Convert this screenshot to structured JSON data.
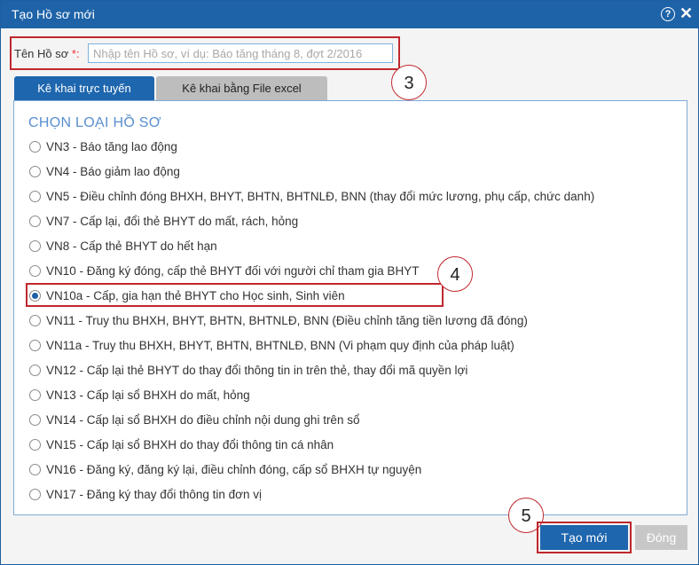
{
  "dialog": {
    "title": "Tạo Hồ sơ mới",
    "help_glyph": "?",
    "close_glyph": "✕"
  },
  "name_field": {
    "label": "Tên Hồ sơ",
    "required_mark": "*:",
    "placeholder": "Nhập tên Hồ sơ, ví dụ: Báo tăng tháng 8, đợt 2/2016",
    "value": ""
  },
  "tabs": [
    {
      "label": "Kê khai trực tuyến",
      "active": true
    },
    {
      "label": "Kê khai bằng File excel",
      "active": false
    }
  ],
  "section_title": "CHỌN LOẠI HỒ SƠ",
  "options": [
    {
      "label": "VN3 - Báo tăng lao động",
      "selected": false
    },
    {
      "label": "VN4 - Báo giảm lao động",
      "selected": false
    },
    {
      "label": "VN5 - Điều chỉnh đóng BHXH, BHYT, BHTN, BHTNLĐ, BNN (thay đổi mức lương, phụ cấp, chức danh)",
      "selected": false
    },
    {
      "label": "VN7 - Cấp lại, đổi thẻ BHYT do mất, rách, hỏng",
      "selected": false
    },
    {
      "label": "VN8 - Cấp thẻ BHYT do hết hạn",
      "selected": false
    },
    {
      "label": "VN10 - Đăng ký đóng, cấp thẻ BHYT đối với người chỉ tham gia BHYT",
      "selected": false
    },
    {
      "label": "VN10a - Cấp, gia hạn thẻ BHYT cho Học sinh, Sinh viên",
      "selected": true
    },
    {
      "label": "VN11 - Truy thu BHXH, BHYT, BHTN, BHTNLĐ, BNN (Điều chỉnh tăng tiền lương đã đóng)",
      "selected": false
    },
    {
      "label": "VN11a - Truy thu BHXH, BHYT, BHTN, BHTNLĐ, BNN (Vi phạm quy định của pháp luật)",
      "selected": false
    },
    {
      "label": "VN12 - Cấp lại thẻ BHYT do thay đổi thông tin in trên thẻ, thay đổi mã quyền lợi",
      "selected": false
    },
    {
      "label": "VN13 - Cấp lại sổ BHXH do mất, hỏng",
      "selected": false
    },
    {
      "label": "VN14 - Cấp lại sổ BHXH do điều chỉnh nội dung ghi trên sổ",
      "selected": false
    },
    {
      "label": "VN15 - Cấp lại sổ BHXH do thay đổi thông tin cá nhân",
      "selected": false
    },
    {
      "label": "VN16 - Đăng ký, đăng ký lại, điều chỉnh đóng, cấp sổ BHXH tự nguyện",
      "selected": false
    },
    {
      "label": "VN17 - Đăng ký thay đổi thông tin đơn vị",
      "selected": false
    }
  ],
  "callouts": [
    "3",
    "4",
    "5"
  ],
  "buttons": {
    "create": "Tạo mới",
    "close": "Đóng"
  }
}
